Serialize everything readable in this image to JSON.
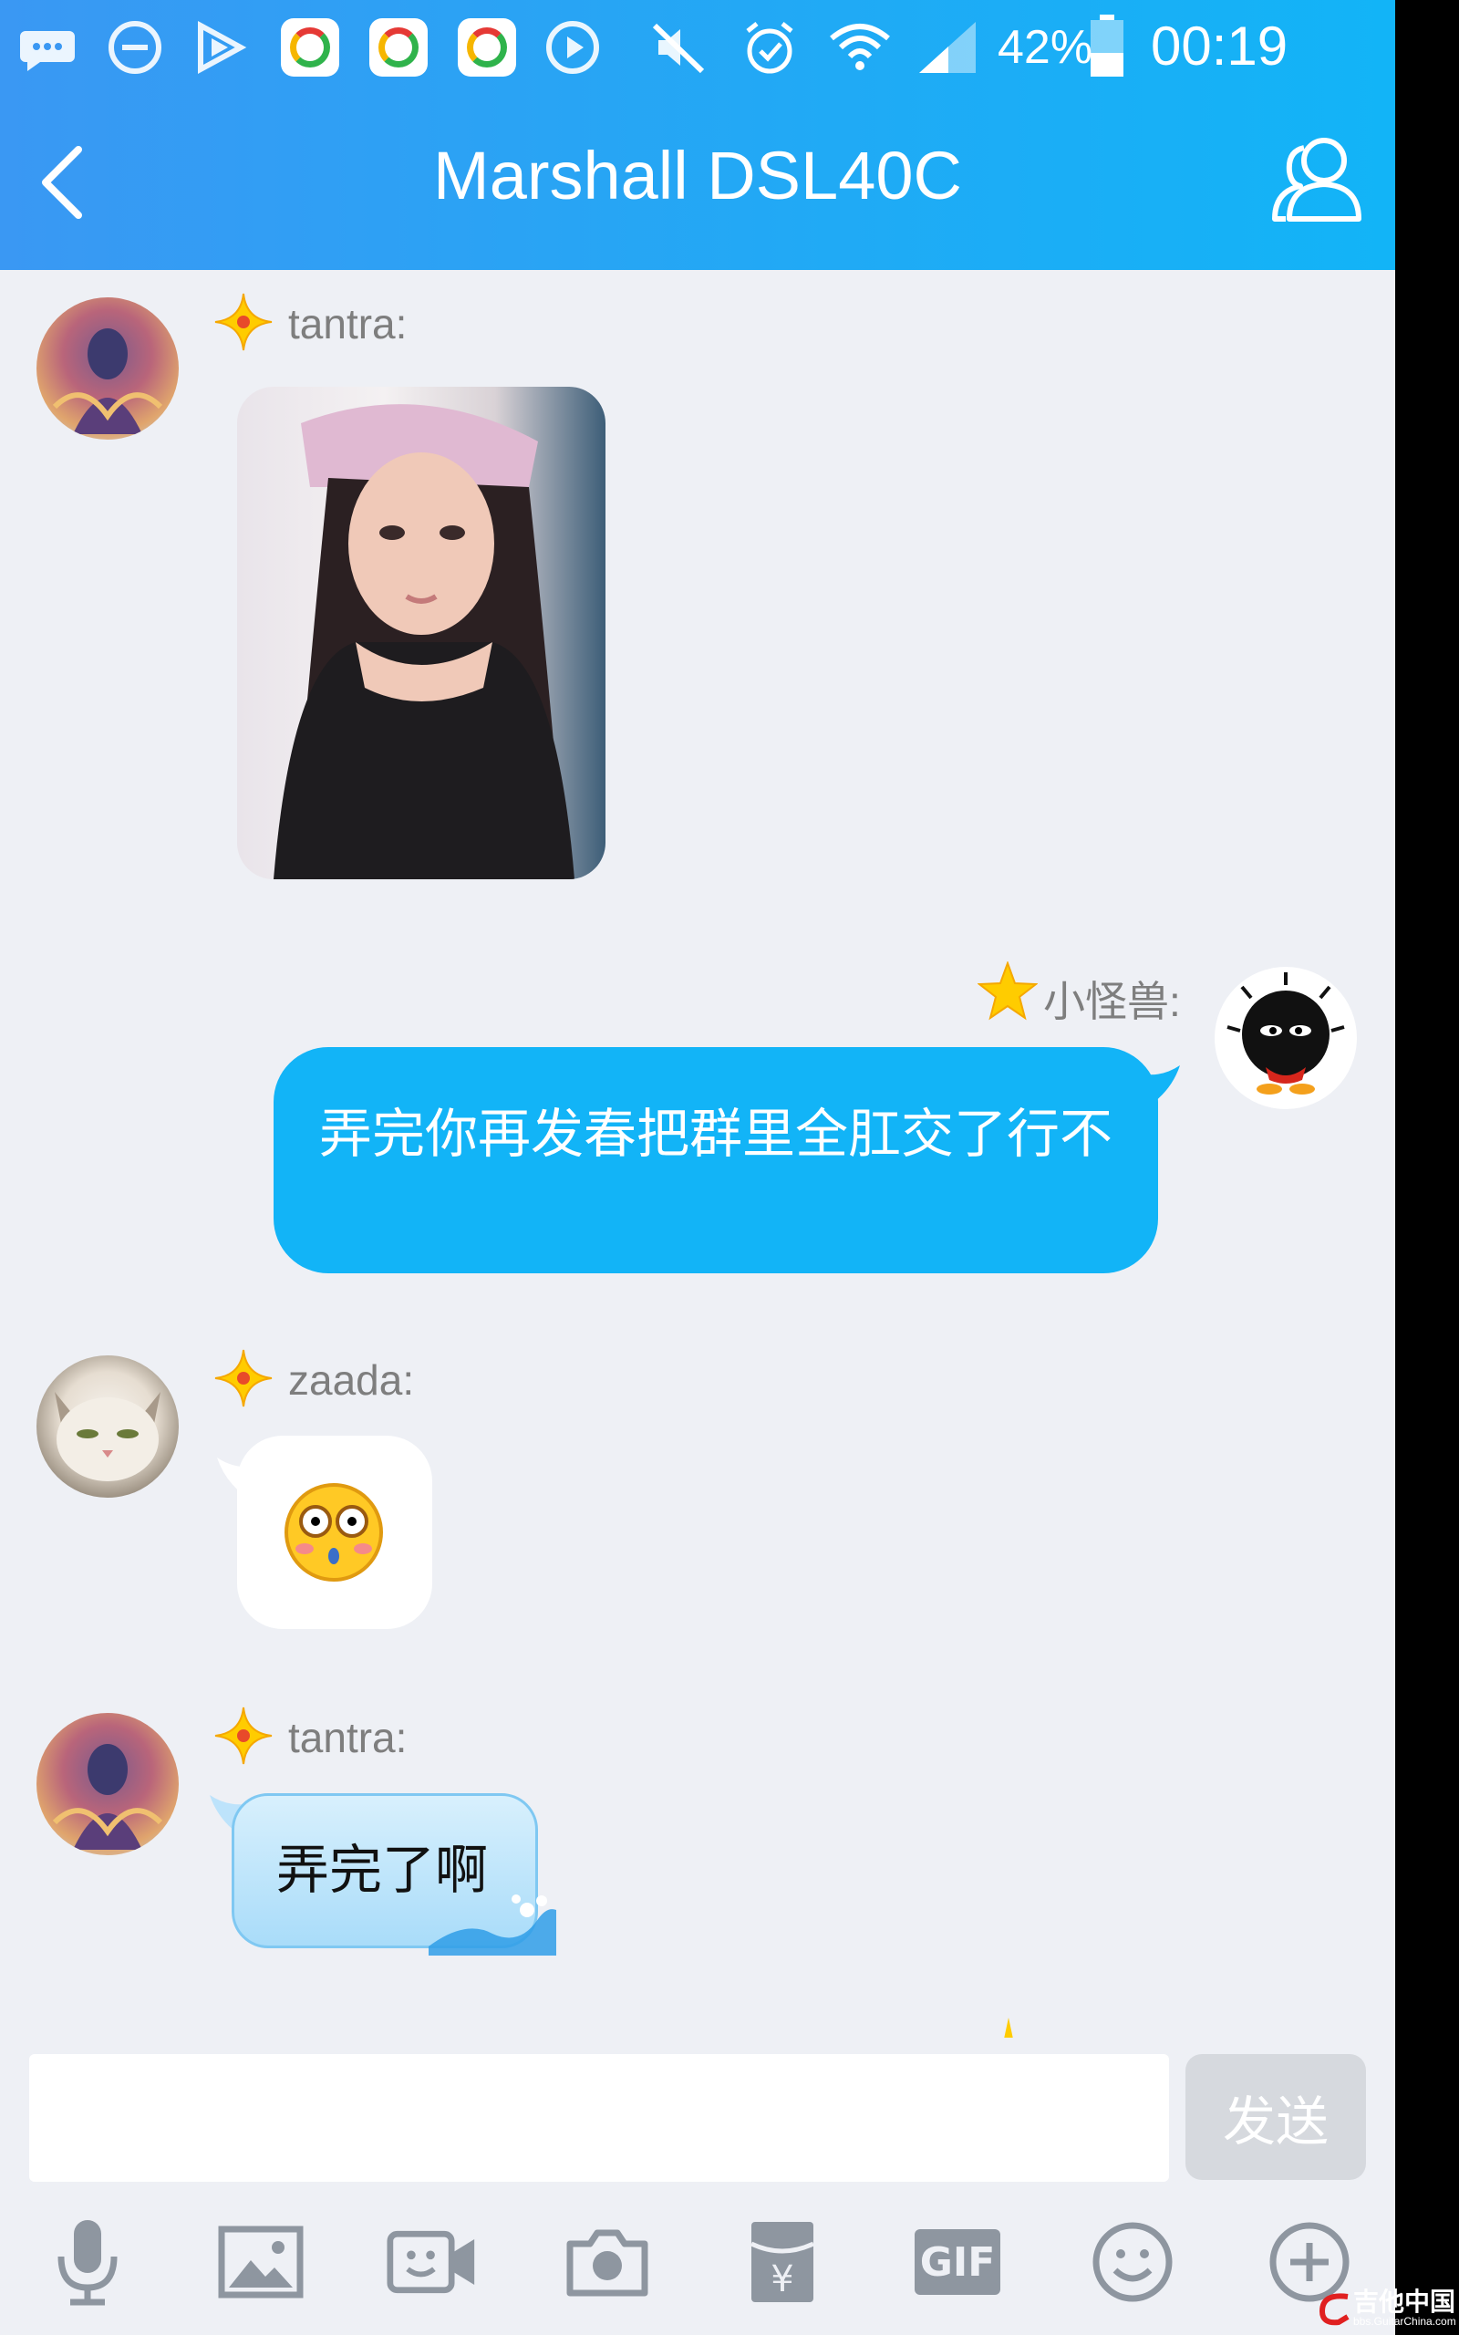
{
  "status_bar": {
    "battery": "42%",
    "time": "00:19"
  },
  "header": {
    "title": "Marshall DSL40C"
  },
  "messages": [
    {
      "sender": "tantra:",
      "type": "image"
    },
    {
      "sender": "小怪兽:",
      "text": "弄完你再发春把群里全肛交了行不"
    },
    {
      "sender": "zaada:",
      "type": "emoji"
    },
    {
      "sender": "tantra:",
      "text": "弄完了啊"
    }
  ],
  "composer": {
    "input_value": "",
    "send_label": "发送"
  },
  "toolbar": {
    "gif_label": "GIF",
    "currency": "¥"
  },
  "watermark": {
    "text": "吉他中国",
    "url": "bbs.GuitarChina.com"
  },
  "colors": {
    "header": "#20aaf5",
    "outgoing_bubble": "#12b4f7",
    "background": "#eef0f5"
  }
}
